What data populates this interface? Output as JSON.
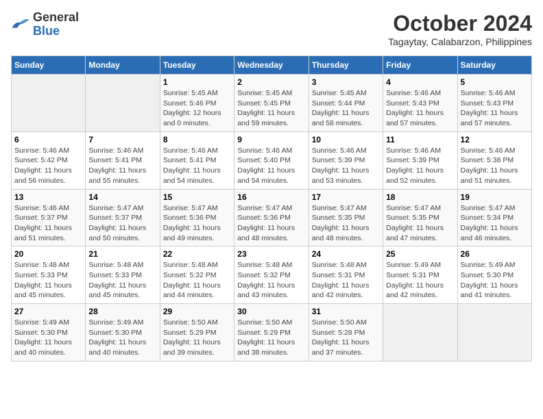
{
  "header": {
    "logo_general": "General",
    "logo_blue": "Blue",
    "month": "October 2024",
    "location": "Tagaytay, Calabarzon, Philippines"
  },
  "weekdays": [
    "Sunday",
    "Monday",
    "Tuesday",
    "Wednesday",
    "Thursday",
    "Friday",
    "Saturday"
  ],
  "weeks": [
    [
      {
        "num": "",
        "info": ""
      },
      {
        "num": "",
        "info": ""
      },
      {
        "num": "1",
        "info": "Sunrise: 5:45 AM\nSunset: 5:46 PM\nDaylight: 12 hours\nand 0 minutes."
      },
      {
        "num": "2",
        "info": "Sunrise: 5:45 AM\nSunset: 5:45 PM\nDaylight: 11 hours\nand 59 minutes."
      },
      {
        "num": "3",
        "info": "Sunrise: 5:45 AM\nSunset: 5:44 PM\nDaylight: 11 hours\nand 58 minutes."
      },
      {
        "num": "4",
        "info": "Sunrise: 5:46 AM\nSunset: 5:43 PM\nDaylight: 11 hours\nand 57 minutes."
      },
      {
        "num": "5",
        "info": "Sunrise: 5:46 AM\nSunset: 5:43 PM\nDaylight: 11 hours\nand 57 minutes."
      }
    ],
    [
      {
        "num": "6",
        "info": "Sunrise: 5:46 AM\nSunset: 5:42 PM\nDaylight: 11 hours\nand 56 minutes."
      },
      {
        "num": "7",
        "info": "Sunrise: 5:46 AM\nSunset: 5:41 PM\nDaylight: 11 hours\nand 55 minutes."
      },
      {
        "num": "8",
        "info": "Sunrise: 5:46 AM\nSunset: 5:41 PM\nDaylight: 11 hours\nand 54 minutes."
      },
      {
        "num": "9",
        "info": "Sunrise: 5:46 AM\nSunset: 5:40 PM\nDaylight: 11 hours\nand 54 minutes."
      },
      {
        "num": "10",
        "info": "Sunrise: 5:46 AM\nSunset: 5:39 PM\nDaylight: 11 hours\nand 53 minutes."
      },
      {
        "num": "11",
        "info": "Sunrise: 5:46 AM\nSunset: 5:39 PM\nDaylight: 11 hours\nand 52 minutes."
      },
      {
        "num": "12",
        "info": "Sunrise: 5:46 AM\nSunset: 5:38 PM\nDaylight: 11 hours\nand 51 minutes."
      }
    ],
    [
      {
        "num": "13",
        "info": "Sunrise: 5:46 AM\nSunset: 5:37 PM\nDaylight: 11 hours\nand 51 minutes."
      },
      {
        "num": "14",
        "info": "Sunrise: 5:47 AM\nSunset: 5:37 PM\nDaylight: 11 hours\nand 50 minutes."
      },
      {
        "num": "15",
        "info": "Sunrise: 5:47 AM\nSunset: 5:36 PM\nDaylight: 11 hours\nand 49 minutes."
      },
      {
        "num": "16",
        "info": "Sunrise: 5:47 AM\nSunset: 5:36 PM\nDaylight: 11 hours\nand 48 minutes."
      },
      {
        "num": "17",
        "info": "Sunrise: 5:47 AM\nSunset: 5:35 PM\nDaylight: 11 hours\nand 48 minutes."
      },
      {
        "num": "18",
        "info": "Sunrise: 5:47 AM\nSunset: 5:35 PM\nDaylight: 11 hours\nand 47 minutes."
      },
      {
        "num": "19",
        "info": "Sunrise: 5:47 AM\nSunset: 5:34 PM\nDaylight: 11 hours\nand 46 minutes."
      }
    ],
    [
      {
        "num": "20",
        "info": "Sunrise: 5:48 AM\nSunset: 5:33 PM\nDaylight: 11 hours\nand 45 minutes."
      },
      {
        "num": "21",
        "info": "Sunrise: 5:48 AM\nSunset: 5:33 PM\nDaylight: 11 hours\nand 45 minutes."
      },
      {
        "num": "22",
        "info": "Sunrise: 5:48 AM\nSunset: 5:32 PM\nDaylight: 11 hours\nand 44 minutes."
      },
      {
        "num": "23",
        "info": "Sunrise: 5:48 AM\nSunset: 5:32 PM\nDaylight: 11 hours\nand 43 minutes."
      },
      {
        "num": "24",
        "info": "Sunrise: 5:48 AM\nSunset: 5:31 PM\nDaylight: 11 hours\nand 42 minutes."
      },
      {
        "num": "25",
        "info": "Sunrise: 5:49 AM\nSunset: 5:31 PM\nDaylight: 11 hours\nand 42 minutes."
      },
      {
        "num": "26",
        "info": "Sunrise: 5:49 AM\nSunset: 5:30 PM\nDaylight: 11 hours\nand 41 minutes."
      }
    ],
    [
      {
        "num": "27",
        "info": "Sunrise: 5:49 AM\nSunset: 5:30 PM\nDaylight: 11 hours\nand 40 minutes."
      },
      {
        "num": "28",
        "info": "Sunrise: 5:49 AM\nSunset: 5:30 PM\nDaylight: 11 hours\nand 40 minutes."
      },
      {
        "num": "29",
        "info": "Sunrise: 5:50 AM\nSunset: 5:29 PM\nDaylight: 11 hours\nand 39 minutes."
      },
      {
        "num": "30",
        "info": "Sunrise: 5:50 AM\nSunset: 5:29 PM\nDaylight: 11 hours\nand 38 minutes."
      },
      {
        "num": "31",
        "info": "Sunrise: 5:50 AM\nSunset: 5:28 PM\nDaylight: 11 hours\nand 37 minutes."
      },
      {
        "num": "",
        "info": ""
      },
      {
        "num": "",
        "info": ""
      }
    ]
  ]
}
